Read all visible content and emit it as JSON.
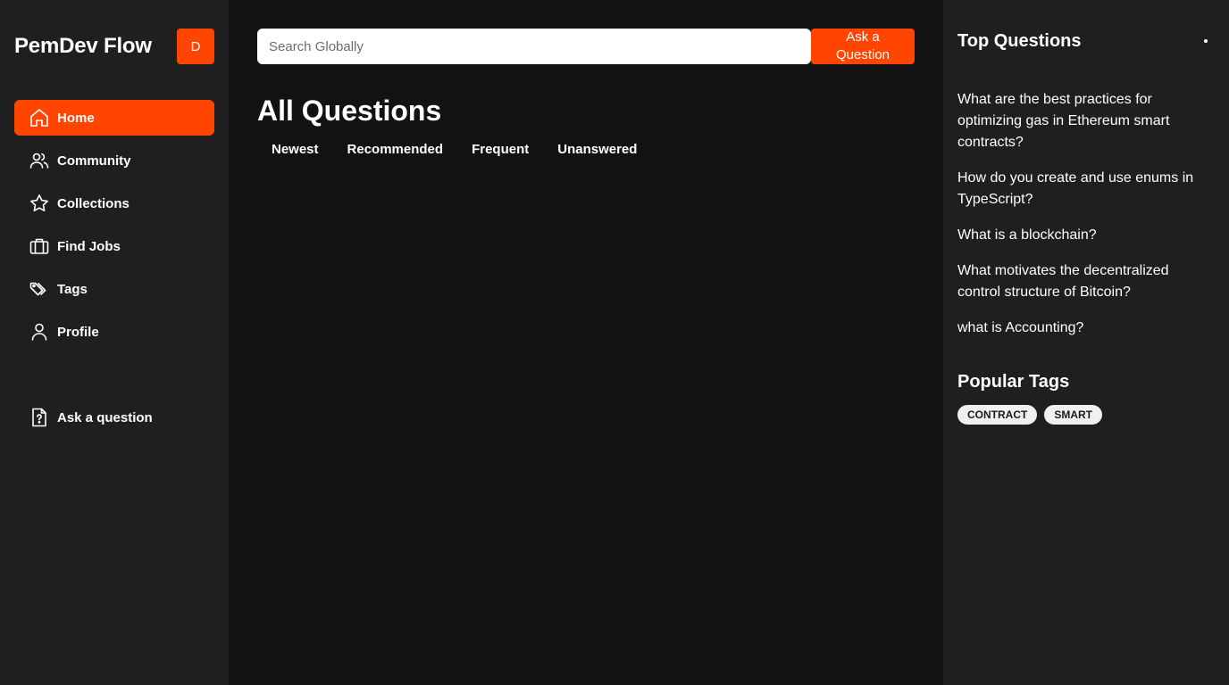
{
  "sidebar": {
    "brand": "PemDev Flow",
    "avatar_initial": "D",
    "items": [
      {
        "label": "Home",
        "icon": "home-icon"
      },
      {
        "label": "Community",
        "icon": "users-icon"
      },
      {
        "label": "Collections",
        "icon": "star-icon"
      },
      {
        "label": "Find Jobs",
        "icon": "briefcase-icon"
      },
      {
        "label": "Tags",
        "icon": "tag-icon"
      },
      {
        "label": "Profile",
        "icon": "user-icon"
      }
    ],
    "ask_label": "Ask a question",
    "active_item": "Home"
  },
  "search": {
    "placeholder": "Search Globally",
    "value": ""
  },
  "header": {
    "ask_button_label": "Ask a Question"
  },
  "main": {
    "title": "All Questions",
    "filters": [
      "Newest",
      "Recommended",
      "Frequent",
      "Unanswered"
    ]
  },
  "right_sidebar": {
    "top_questions_title": "Top Questions",
    "top_questions": [
      "What are the best practices for optimizing gas in Ethereum smart contracts?",
      "How do you create and use enums in TypeScript?",
      "What is a blockchain?",
      "What motivates the decentralized control structure of Bitcoin?",
      "what is Accounting?"
    ],
    "popular_tags_title": "Popular Tags",
    "tags": [
      "CONTRACT",
      "SMART"
    ]
  },
  "colors": {
    "accent": "#ff4500",
    "sidebar_bg": "#1f1f1f",
    "main_bg": "#121212"
  }
}
